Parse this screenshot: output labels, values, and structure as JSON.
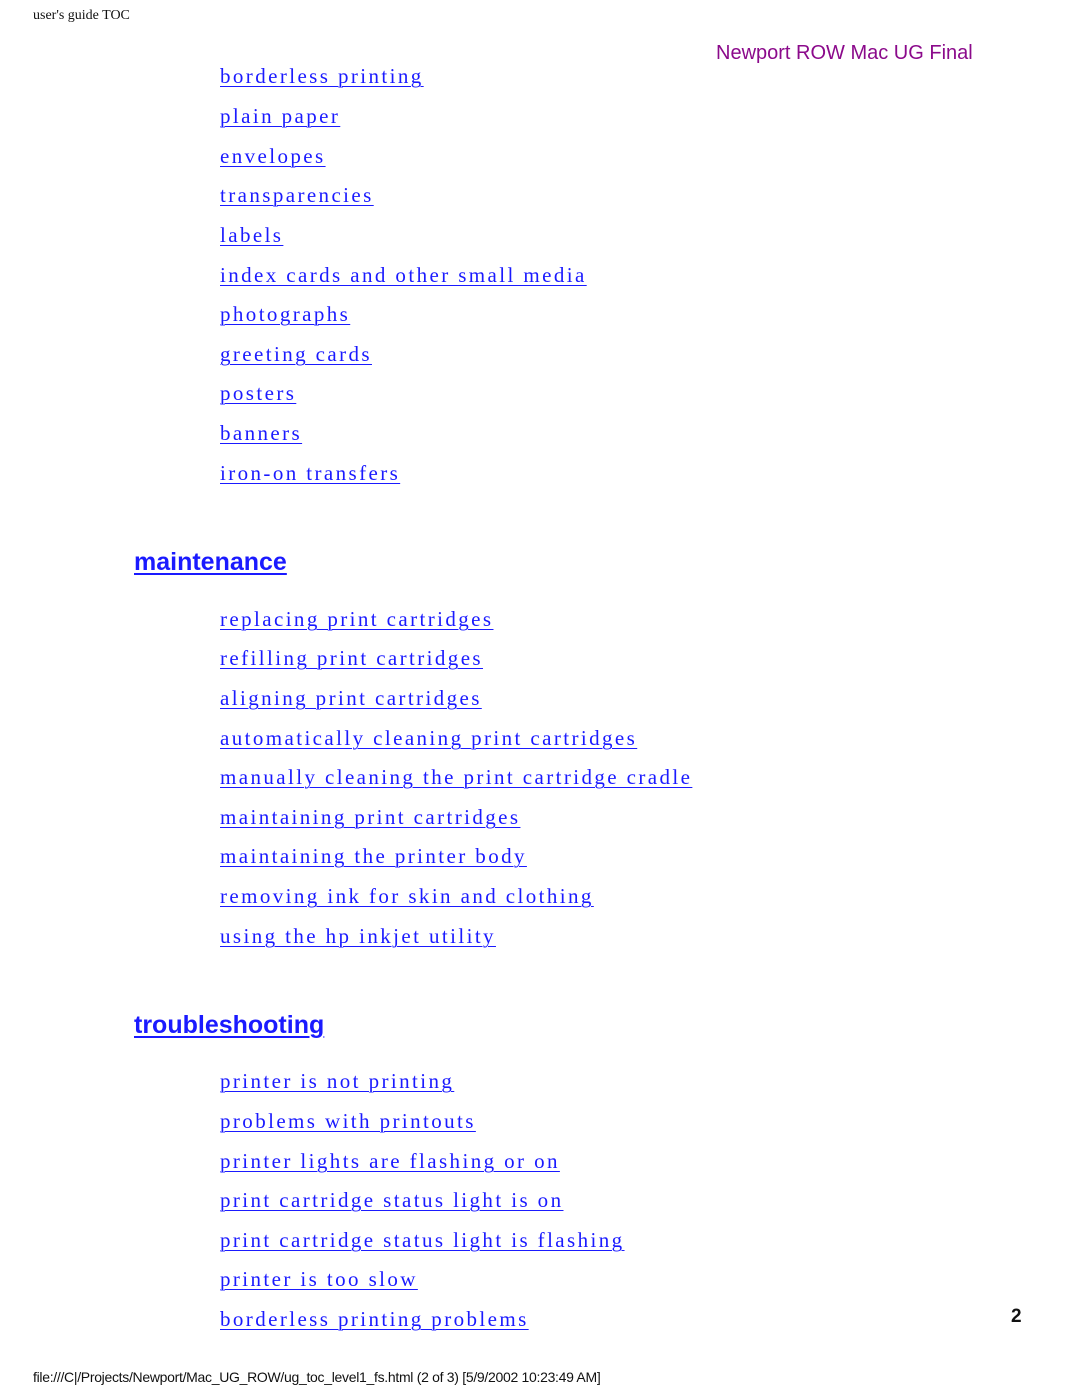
{
  "header": {
    "left_title": "user's guide TOC",
    "right_title": "Newport ROW Mac UG Final"
  },
  "paper_types": {
    "items": [
      "borderless printing",
      "plain paper",
      "envelopes",
      "transparencies",
      "labels",
      "index cards and other small media",
      "photographs",
      "greeting cards",
      "posters",
      "banners",
      "iron-on transfers"
    ]
  },
  "maintenance": {
    "heading": "maintenance",
    "items": [
      "replacing print cartridges",
      "refilling print cartridges",
      "aligning print cartridges",
      "automatically cleaning print cartridges",
      "manually cleaning the print cartridge cradle",
      "maintaining print cartridges",
      "maintaining the printer body",
      "removing ink for skin and clothing",
      "using the hp inkjet utility"
    ]
  },
  "troubleshooting": {
    "heading": "troubleshooting",
    "items": [
      "printer is not printing",
      "problems with printouts",
      "printer lights are flashing or on",
      "print cartridge status light is on",
      "print cartridge status light is flashing",
      "printer is too slow",
      "borderless printing problems"
    ]
  },
  "page_number": "2",
  "footer": {
    "path": "file:///C|/Projects/Newport/Mac_UG_ROW/ug_toc_level1_fs.html (2 of 3) [5/9/2002 10:23:49 AM]"
  },
  "colors": {
    "link": "#1a1aff",
    "header_accent": "#8b0a8b"
  }
}
